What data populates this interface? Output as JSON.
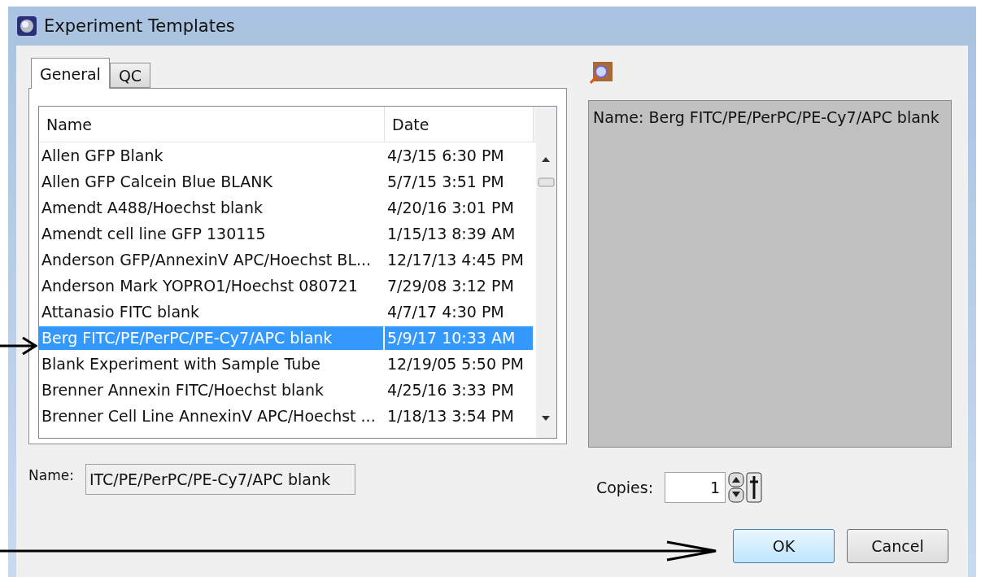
{
  "window": {
    "title": "Experiment Templates"
  },
  "tabs": [
    {
      "label": "General",
      "selected": true
    },
    {
      "label": "QC",
      "selected": false
    }
  ],
  "table": {
    "columns": [
      "Name",
      "Date"
    ],
    "rows": [
      {
        "name": "Allen GFP Blank",
        "date": "4/3/15 6:30 PM",
        "selected": false
      },
      {
        "name": "Allen GFP Calcein Blue BLANK",
        "date": "5/7/15 3:51 PM",
        "selected": false
      },
      {
        "name": "Amendt A488/Hoechst blank",
        "date": "4/20/16 3:01 PM",
        "selected": false
      },
      {
        "name": "Amendt cell line GFP 130115",
        "date": "1/15/13 8:39 AM",
        "selected": false
      },
      {
        "name": "Anderson GFP/AnnexinV APC/Hoechst BL...",
        "date": "12/17/13 4:45 PM",
        "selected": false
      },
      {
        "name": "Anderson Mark YOPRO1/Hoechst 080721",
        "date": "7/29/08 3:12 PM",
        "selected": false
      },
      {
        "name": "Attanasio FITC blank",
        "date": "4/7/17 4:30 PM",
        "selected": false
      },
      {
        "name": "Berg FITC/PE/PerPC/PE-Cy7/APC blank",
        "date": "5/9/17 10:33 AM",
        "selected": true
      },
      {
        "name": "Blank Experiment with Sample Tube",
        "date": "12/19/05 5:50 PM",
        "selected": false
      },
      {
        "name": "Brenner Annexin FITC/Hoechst blank",
        "date": "4/25/16 3:33 PM",
        "selected": false
      },
      {
        "name": "Brenner Cell Line AnnexinV APC/Hoechst ...",
        "date": "1/18/13 3:54 PM",
        "selected": false
      }
    ]
  },
  "preview": {
    "text": "Name: Berg FITC/PE/PerPC/PE-Cy7/APC blank"
  },
  "name_field": {
    "label": "Name:",
    "value": "ITC/PE/PerPC/PE-Cy7/APC blank"
  },
  "copies": {
    "label": "Copies:",
    "value": "1"
  },
  "buttons": [
    {
      "label": "OK",
      "default": true
    },
    {
      "label": "Cancel",
      "default": false
    }
  ]
}
